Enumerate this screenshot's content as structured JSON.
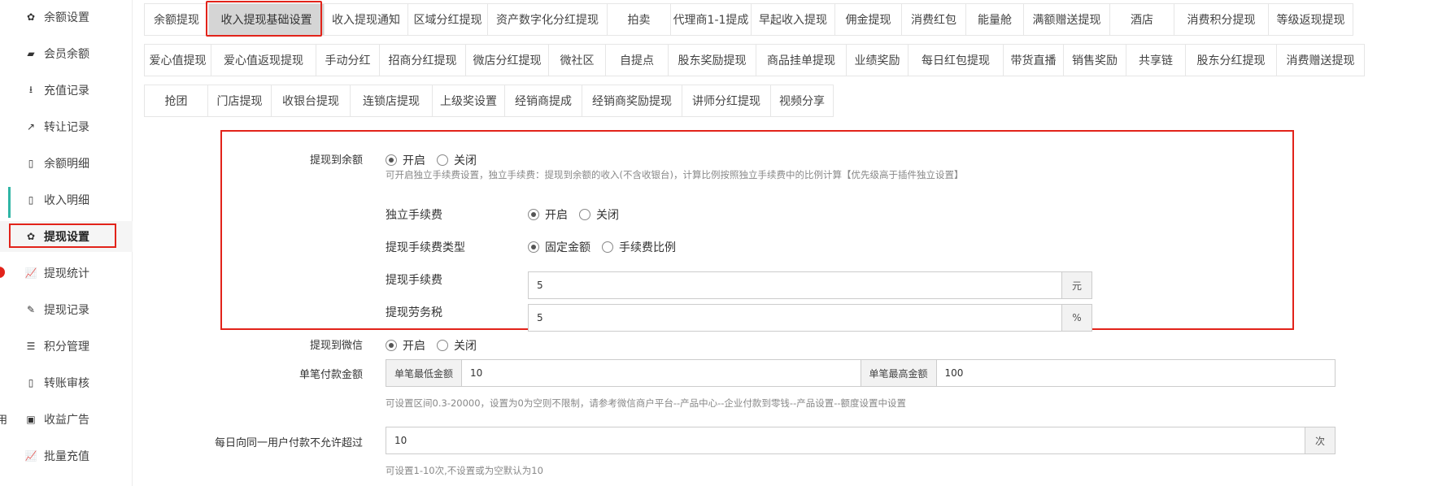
{
  "sidebar": {
    "items": [
      {
        "label": "余额设置",
        "icon": "gear-icon",
        "glyph": "✿"
      },
      {
        "label": "会员余额",
        "icon": "book-icon",
        "glyph": "▰"
      },
      {
        "label": "充值记录",
        "icon": "download-icon",
        "glyph": "⭳"
      },
      {
        "label": "转让记录",
        "icon": "external-link-icon",
        "glyph": "↗"
      },
      {
        "label": "余额明细",
        "icon": "file-icon",
        "glyph": "▯"
      },
      {
        "label": "收入明细",
        "icon": "file-icon",
        "glyph": "▯"
      },
      {
        "label": "提现设置",
        "icon": "gear-icon",
        "glyph": "✿"
      },
      {
        "label": "提现统计",
        "icon": "line-chart-icon",
        "glyph": "📈"
      },
      {
        "label": "提现记录",
        "icon": "pencil-icon",
        "glyph": "✎"
      },
      {
        "label": "积分管理",
        "icon": "database-icon",
        "glyph": "☰"
      },
      {
        "label": "转账审核",
        "icon": "file-icon",
        "glyph": "▯"
      },
      {
        "label": "收益广告",
        "icon": "image-icon",
        "glyph": "▣"
      },
      {
        "label": "批量充值",
        "icon": "line-chart-icon",
        "glyph": "📈"
      }
    ],
    "active_index": 6,
    "edge_char": "用"
  },
  "tabs": {
    "row1": [
      "余额提现",
      "收入提现基础设置",
      "收入提现通知",
      "区域分红提现",
      "资产数字化分红提现",
      "拍卖",
      "代理商1-1提成",
      "早起收入提现",
      "佣金提现",
      "消费红包",
      "能量舱",
      "满额赠送提现",
      "酒店",
      "消费积分提现",
      "等级返现提现"
    ],
    "row2": [
      "爱心值提现",
      "爱心值返现提现",
      "手动分红",
      "招商分红提现",
      "微店分红提现",
      "微社区",
      "自提点",
      "股东奖励提现",
      "商品挂单提现",
      "业绩奖励",
      "每日红包提现",
      "带货直播",
      "销售奖励",
      "共享链",
      "股东分红提现",
      "消费赠送提现"
    ],
    "row3": [
      "抢团",
      "门店提现",
      "收银台提现",
      "连锁店提现",
      "上级奖设置",
      "经销商提成",
      "经销商奖励提现",
      "讲师分红提现",
      "视频分享"
    ],
    "active": "收入提现基础设置"
  },
  "form": {
    "balance": {
      "label": "提现到余额",
      "on": "开启",
      "off": "关闭",
      "selected": "on",
      "hint": "可开启独立手续费设置，独立手续费：提现到余额的收入(不含收银台)，计算比例按照独立手续费中的比例计算【优先级高于插件独立设置】"
    },
    "independent_fee": {
      "label": "独立手续费",
      "on": "开启",
      "off": "关闭",
      "selected": "on"
    },
    "fee_type": {
      "label": "提现手续费类型",
      "fixed": "固定金额",
      "ratio": "手续费比例",
      "selected": "fixed"
    },
    "fee": {
      "label": "提现手续费",
      "value": "5",
      "unit": "元"
    },
    "labor_tax": {
      "label": "提现劳务税",
      "value": "5",
      "unit": "%"
    },
    "wechat": {
      "label": "提现到微信",
      "on": "开启",
      "off": "关闭",
      "selected": "on"
    },
    "single_amount": {
      "label": "单笔付款金额",
      "min_label": "单笔最低金额",
      "min_value": "10",
      "max_label": "单笔最高金额",
      "max_value": "100",
      "hint": "可设置区间0.3-20000，设置为0为空则不限制，请参考微信商户平台--产品中心--企业付款到零钱--产品设置--额度设置中设置"
    },
    "daily_limit": {
      "label": "每日向同一用户付款不允许超过",
      "value": "10",
      "unit": "次",
      "hint": "可设置1-10次,不设置或为空默认为10"
    }
  },
  "colors": {
    "highlight": "#e2231a",
    "active_tab_bg": "#d5d5d5"
  }
}
